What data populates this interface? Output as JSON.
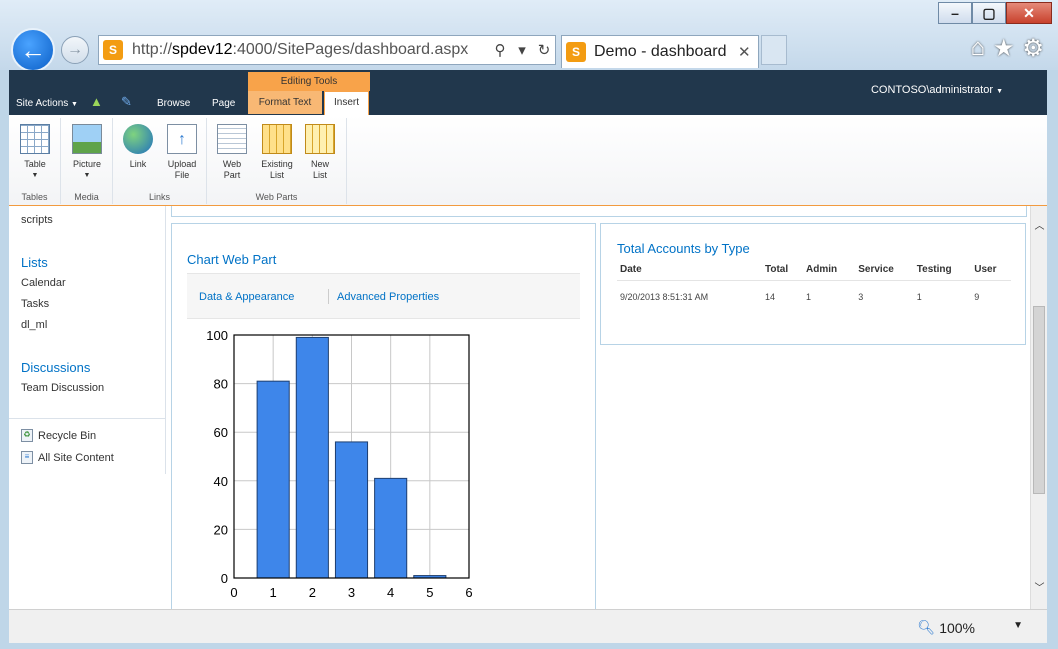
{
  "browser": {
    "url_prefix": "http://",
    "url_host": "spdev12",
    "url_rest": ":4000/SitePages/dashboard.aspx",
    "tab_title": "Demo - dashboard",
    "zoom": "100%",
    "minimize": "–",
    "maximize": "▢",
    "close": "✕",
    "back_glyph": "←",
    "forward_glyph": "→",
    "search_glyph": "⚲",
    "refresh_glyph": "↻",
    "tab_close_glyph": "✕",
    "home_glyph": "⌂",
    "favorites_glyph": "★",
    "tools_glyph": "⚙"
  },
  "header": {
    "site_actions": "Site Actions",
    "browse": "Browse",
    "page": "Page",
    "editing_tools": "Editing Tools",
    "format_text": "Format Text",
    "insert": "Insert",
    "user": "CONTOSO\\administrator"
  },
  "ribbon": {
    "groups": [
      {
        "label": "Tables",
        "buttons": [
          {
            "label": "Table",
            "icon": "table-icon"
          }
        ]
      },
      {
        "label": "Media",
        "buttons": [
          {
            "label": "Picture",
            "icon": "picture-icon"
          }
        ]
      },
      {
        "label": "Links",
        "buttons": [
          {
            "label": "Link",
            "icon": "link-icon"
          },
          {
            "label": "Upload File",
            "icon": "upload-file-icon"
          }
        ]
      },
      {
        "label": "Web Parts",
        "buttons": [
          {
            "label": "Web Part",
            "icon": "web-part-icon"
          },
          {
            "label": "Existing List",
            "icon": "existing-list-icon"
          },
          {
            "label": "New List",
            "icon": "new-list-icon"
          }
        ]
      }
    ],
    "table_l1": "Table",
    "picture_l1": "Picture",
    "link_l1": "Link",
    "upload_l1": "Upload",
    "upload_l2": "File",
    "webpart_l1": "Web",
    "webpart_l2": "Part",
    "existing_l1": "Existing",
    "existing_l2": "List",
    "newlist_l1": "New",
    "newlist_l2": "List"
  },
  "quicklaunch": {
    "scripts": "scripts",
    "lists_heading": "Lists",
    "calendar": "Calendar",
    "tasks": "Tasks",
    "dl_ml": "dl_ml",
    "discussions_heading": "Discussions",
    "team_discussion": "Team Discussion",
    "recycle_bin": "Recycle Bin",
    "all_site_content": "All Site Content"
  },
  "chart_webpart": {
    "title": "Chart Web Part",
    "data_appearance": "Data & Appearance",
    "advanced_properties": "Advanced Properties"
  },
  "accounts": {
    "title": "Total Accounts by Type",
    "columns": [
      "Date",
      "Total",
      "Admin",
      "Service",
      "Testing",
      "User"
    ],
    "rows": [
      [
        "9/20/2013 8:51:31 AM",
        "14",
        "1",
        "3",
        "1",
        "9"
      ]
    ]
  },
  "chart_data": {
    "type": "bar",
    "categories": [
      "1",
      "2",
      "3",
      "4",
      "5"
    ],
    "values": [
      81,
      99,
      56,
      41,
      1
    ],
    "title": "",
    "xlabel": "",
    "ylabel": "",
    "xlim": [
      0,
      6
    ],
    "ylim": [
      0,
      100
    ],
    "xticks": [
      "0",
      "1",
      "2",
      "3",
      "4",
      "5",
      "6"
    ],
    "yticks": [
      "0",
      "20",
      "40",
      "60",
      "80",
      "100"
    ],
    "grid": true,
    "bar_color": "#3e86ea"
  },
  "colors": {
    "header_bg": "#21374c",
    "accent_orange": "#f8a34a",
    "link_blue": "#0072c6"
  }
}
